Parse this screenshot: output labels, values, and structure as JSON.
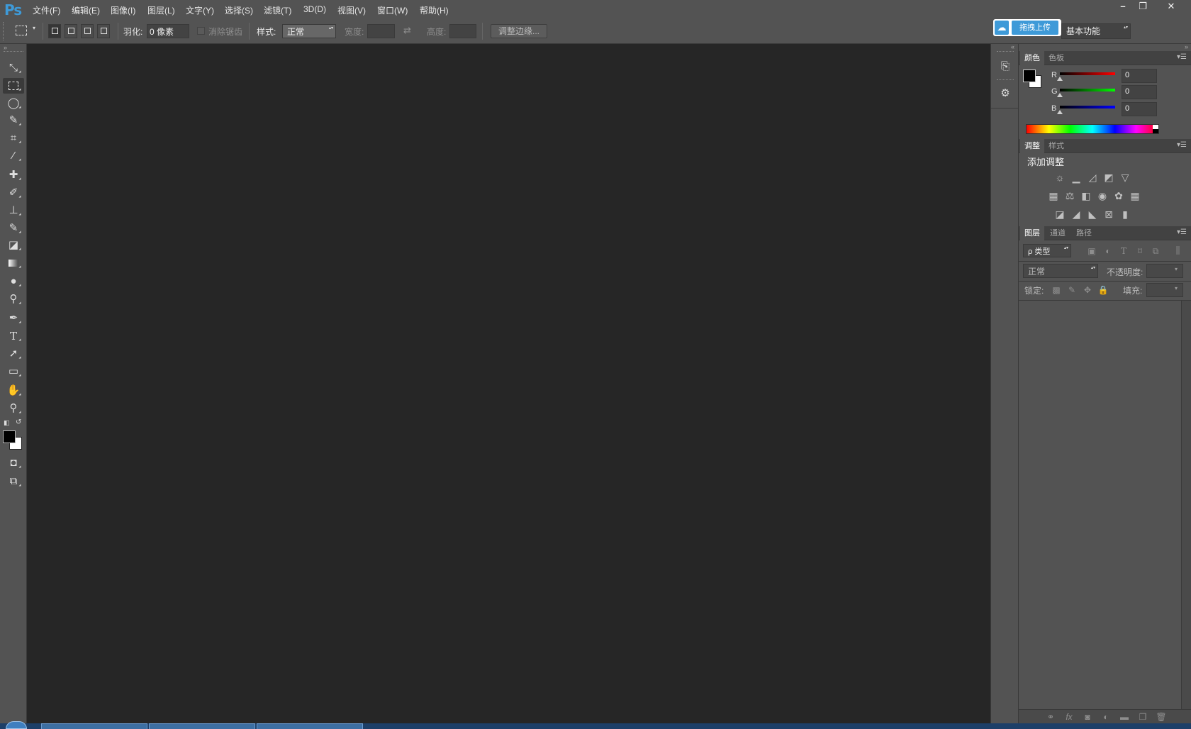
{
  "app": {
    "logo": "Ps"
  },
  "menu": [
    {
      "label": "文件(F)"
    },
    {
      "label": "编辑(E)"
    },
    {
      "label": "图像(I)"
    },
    {
      "label": "图层(L)"
    },
    {
      "label": "文字(Y)"
    },
    {
      "label": "选择(S)"
    },
    {
      "label": "滤镜(T)"
    },
    {
      "label": "3D(D)"
    },
    {
      "label": "视图(V)"
    },
    {
      "label": "窗口(W)"
    },
    {
      "label": "帮助(H)"
    }
  ],
  "window_controls": {
    "minimize": "–",
    "restore": "❐",
    "close": "✕"
  },
  "upload_widget": {
    "label": "拖拽上传"
  },
  "workspace": {
    "value": "基本功能"
  },
  "options": {
    "feather_label": "羽化:",
    "feather_value": "0 像素",
    "antialias_label": "消除锯齿",
    "style_label": "样式:",
    "style_value": "正常",
    "width_label": "宽度:",
    "height_label": "高度:",
    "refine_edge_label": "调整边缘..."
  },
  "color_panel": {
    "tabs": [
      {
        "label": "颜色"
      },
      {
        "label": "色板"
      }
    ],
    "channels": [
      {
        "name": "R",
        "value": "0",
        "color": "#ff0000"
      },
      {
        "name": "G",
        "value": "0",
        "color": "#00ff00"
      },
      {
        "name": "B",
        "value": "0",
        "color": "#0000ff"
      }
    ],
    "foreground": "#000000",
    "background": "#ffffff"
  },
  "adjust_panel": {
    "tabs": [
      {
        "label": "调整"
      },
      {
        "label": "样式"
      }
    ],
    "heading": "添加调整"
  },
  "layers_panel": {
    "tabs": [
      {
        "label": "图层"
      },
      {
        "label": "通道"
      },
      {
        "label": "路径"
      }
    ],
    "filter_label": "ρ 类型",
    "blend_mode": "正常",
    "opacity_label": "不透明度:",
    "lock_label": "锁定:",
    "fill_label": "填充:"
  },
  "colors": {
    "accent": "#3e9ad8",
    "panel": "#535353",
    "canvas": "#262626"
  }
}
